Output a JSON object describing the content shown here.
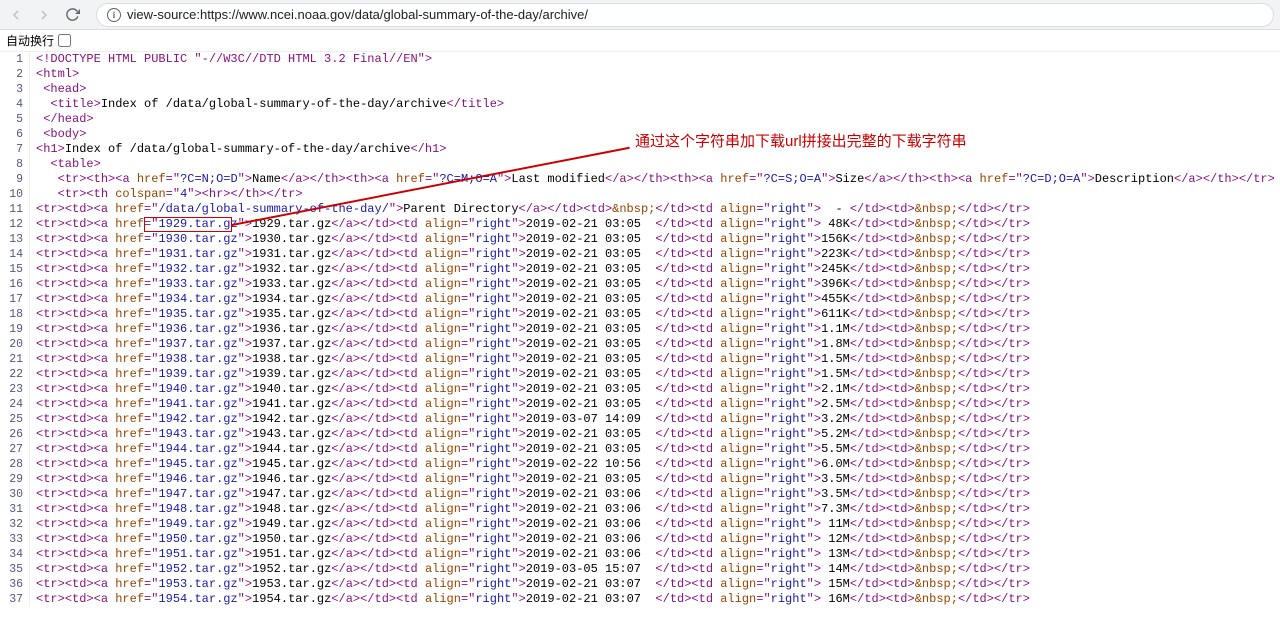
{
  "toolbar": {
    "url_prefix": "view-source:",
    "url": "https://www.ncei.noaa.gov/data/global-summary-of-the-day/archive/"
  },
  "autowrap_label": "自动换行",
  "annotation_text": "通过这个字符串加下载url拼接出完整的下载字符串",
  "source": {
    "doctype": "<!DOCTYPE HTML PUBLIC \"-//W3C//DTD HTML 3.2 Final//EN\">",
    "title_text": "Index of /data/global-summary-of-the-day/archive",
    "h1_text": "Index of /data/global-summary-of-the-day/archive",
    "headers": {
      "name": {
        "href": "?C=N;O=D",
        "label": "Name"
      },
      "modified": {
        "href": "?C=M;O=A",
        "label": "Last modified"
      },
      "size": {
        "href": "?C=S;O=A",
        "label": "Size"
      },
      "desc": {
        "href": "?C=D;O=A",
        "label": "Description"
      }
    },
    "parent": {
      "href": "/data/global-summary-of-the-day/",
      "label": "Parent Directory",
      "date_cell": "&nbsp;",
      "size": "  - "
    },
    "rows": [
      {
        "file": "1929.tar.gz",
        "date": "2019-02-21 03:05",
        "size": " 48K"
      },
      {
        "file": "1930.tar.gz",
        "date": "2019-02-21 03:05",
        "size": "156K"
      },
      {
        "file": "1931.tar.gz",
        "date": "2019-02-21 03:05",
        "size": "223K"
      },
      {
        "file": "1932.tar.gz",
        "date": "2019-02-21 03:05",
        "size": "245K"
      },
      {
        "file": "1933.tar.gz",
        "date": "2019-02-21 03:05",
        "size": "396K"
      },
      {
        "file": "1934.tar.gz",
        "date": "2019-02-21 03:05",
        "size": "455K"
      },
      {
        "file": "1935.tar.gz",
        "date": "2019-02-21 03:05",
        "size": "611K"
      },
      {
        "file": "1936.tar.gz",
        "date": "2019-02-21 03:05",
        "size": "1.1M"
      },
      {
        "file": "1937.tar.gz",
        "date": "2019-02-21 03:05",
        "size": "1.8M"
      },
      {
        "file": "1938.tar.gz",
        "date": "2019-02-21 03:05",
        "size": "1.5M"
      },
      {
        "file": "1939.tar.gz",
        "date": "2019-02-21 03:05",
        "size": "1.5M"
      },
      {
        "file": "1940.tar.gz",
        "date": "2019-02-21 03:05",
        "size": "2.1M"
      },
      {
        "file": "1941.tar.gz",
        "date": "2019-02-21 03:05",
        "size": "2.5M"
      },
      {
        "file": "1942.tar.gz",
        "date": "2019-03-07 14:09",
        "size": "3.2M"
      },
      {
        "file": "1943.tar.gz",
        "date": "2019-02-21 03:05",
        "size": "5.2M"
      },
      {
        "file": "1944.tar.gz",
        "date": "2019-02-21 03:05",
        "size": "5.5M"
      },
      {
        "file": "1945.tar.gz",
        "date": "2019-02-22 10:56",
        "size": "6.0M"
      },
      {
        "file": "1946.tar.gz",
        "date": "2019-02-21 03:05",
        "size": "3.5M"
      },
      {
        "file": "1947.tar.gz",
        "date": "2019-02-21 03:06",
        "size": "3.5M"
      },
      {
        "file": "1948.tar.gz",
        "date": "2019-02-21 03:06",
        "size": "7.3M"
      },
      {
        "file": "1949.tar.gz",
        "date": "2019-02-21 03:06",
        "size": " 11M"
      },
      {
        "file": "1950.tar.gz",
        "date": "2019-02-21 03:06",
        "size": " 12M"
      },
      {
        "file": "1951.tar.gz",
        "date": "2019-02-21 03:06",
        "size": " 13M"
      },
      {
        "file": "1952.tar.gz",
        "date": "2019-03-05 15:07",
        "size": " 14M"
      },
      {
        "file": "1953.tar.gz",
        "date": "2019-02-21 03:07",
        "size": " 15M"
      },
      {
        "file": "1954.tar.gz",
        "date": "2019-02-21 03:07",
        "size": " 16M"
      }
    ]
  }
}
